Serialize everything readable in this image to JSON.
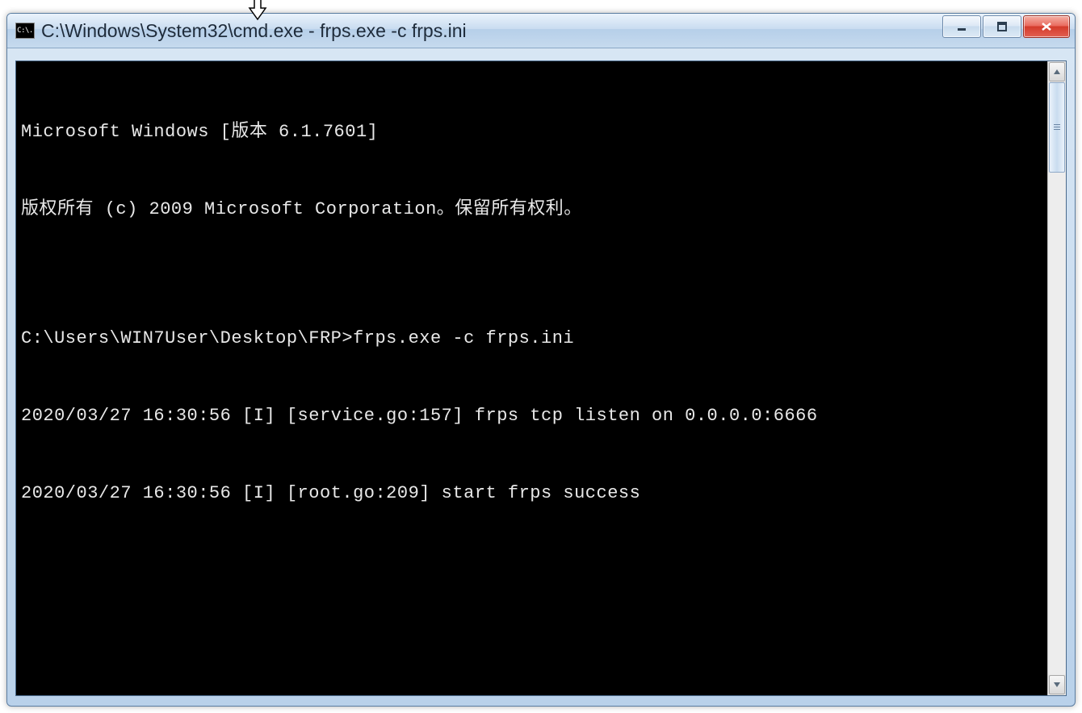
{
  "window": {
    "title": "C:\\Windows\\System32\\cmd.exe - frps.exe  -c frps.ini",
    "app_icon_label": "C:\\."
  },
  "terminal": {
    "lines": [
      "Microsoft Windows [版本 6.1.7601]",
      "版权所有 (c) 2009 Microsoft Corporation。保留所有权利。",
      "",
      "C:\\Users\\WIN7User\\Desktop\\FRP>frps.exe -c frps.ini",
      "2020/03/27 16:30:56 [I] [service.go:157] frps tcp listen on 0.0.0.0:6666",
      "2020/03/27 16:30:56 [I] [root.go:209] start frps success"
    ]
  }
}
